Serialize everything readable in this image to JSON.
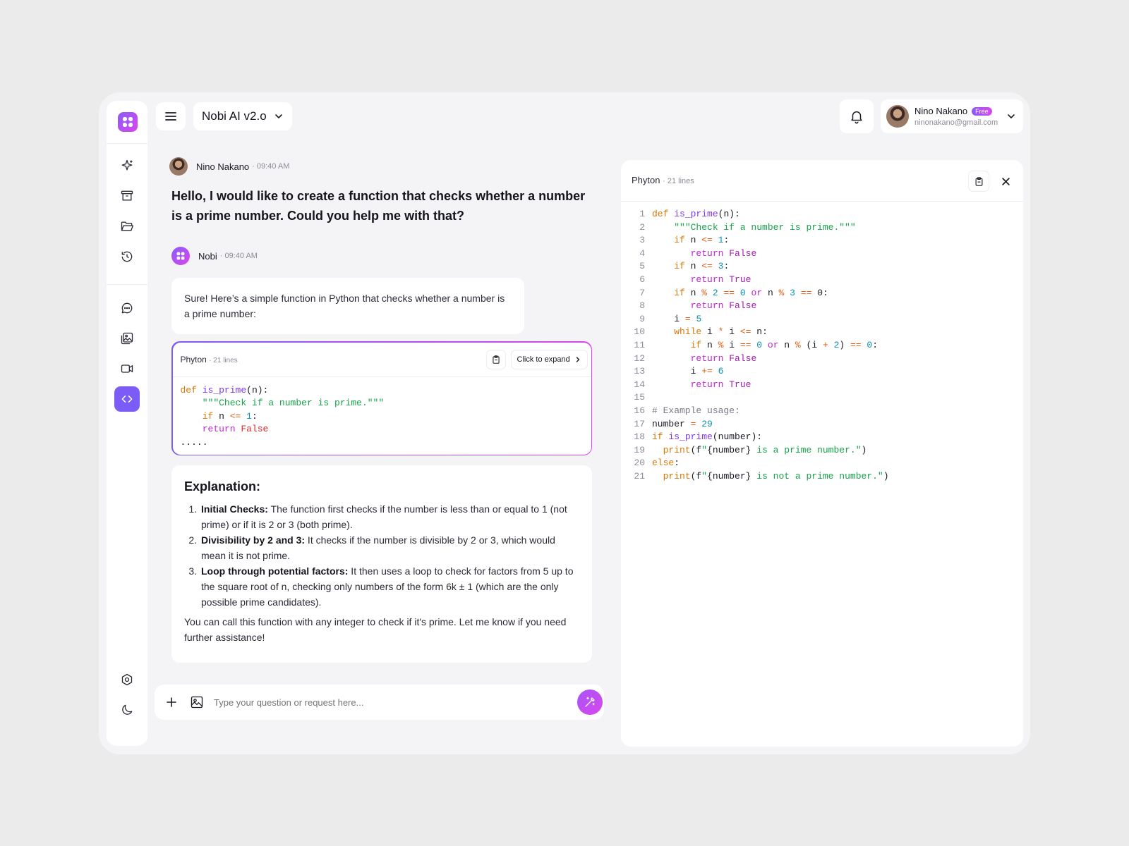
{
  "header": {
    "model_name": "Nobi AI v2.o",
    "user": {
      "name": "Nino Nakano",
      "plan_badge": "Free",
      "email": "ninonakano@gmail.com"
    }
  },
  "sidebar": {
    "items": [
      {
        "icon": "sparkle-icon"
      },
      {
        "icon": "archive-icon"
      },
      {
        "icon": "folder-open-icon"
      },
      {
        "icon": "history-icon"
      },
      {
        "icon": "chat-icon"
      },
      {
        "icon": "image-gallery-icon"
      },
      {
        "icon": "video-icon"
      },
      {
        "icon": "code-icon",
        "active": true
      }
    ],
    "bottom": [
      {
        "icon": "settings-icon"
      },
      {
        "icon": "moon-icon"
      }
    ]
  },
  "chat": {
    "user_message": {
      "author": "Nino Nakano",
      "time": "· 09:40 AM",
      "text": "Hello, I would like to create a function that checks whether a number is a prime number. Could you help me with that?"
    },
    "bot_message": {
      "author": "Nobi",
      "time": "· 09:40 AM",
      "intro": "Sure! Here’s a simple function in Python that checks whether a number is a prime number:",
      "code_card": {
        "language": "Phyton",
        "line_count": "· 21 lines",
        "expand_label": "Click to expand",
        "ellipsis": "....."
      },
      "explanation": {
        "title": "Explanation:",
        "items": [
          {
            "bold": "Initial Checks:",
            "text": " The function first checks if the number is less than or equal to 1 (not prime) or if it is 2 or 3 (both prime)."
          },
          {
            "bold": "Divisibility by 2 and 3:",
            "text": " It checks if the number is divisible by 2 or 3, which would mean it is not prime."
          },
          {
            "bold": "Loop through potential factors:",
            "text": " It then uses a loop to check for factors from 5 up to the square root of n, checking only numbers of the form 6k ± 1 (which are the only possible prime candidates)."
          }
        ],
        "closing": "You can call this function with any integer to check if it's prime. Let me know if you need further assistance!"
      }
    }
  },
  "input": {
    "placeholder": "Type your question or request here..."
  },
  "code_panel": {
    "language": "Phyton",
    "line_count": "· 21 lines",
    "line_numbers": [
      "1",
      "2",
      "3",
      "4",
      "5",
      "6",
      "7",
      "8",
      "9",
      "10",
      "11",
      "12",
      "13",
      "14",
      "15",
      "16",
      "17",
      "18",
      "19",
      "20",
      "21"
    ]
  }
}
